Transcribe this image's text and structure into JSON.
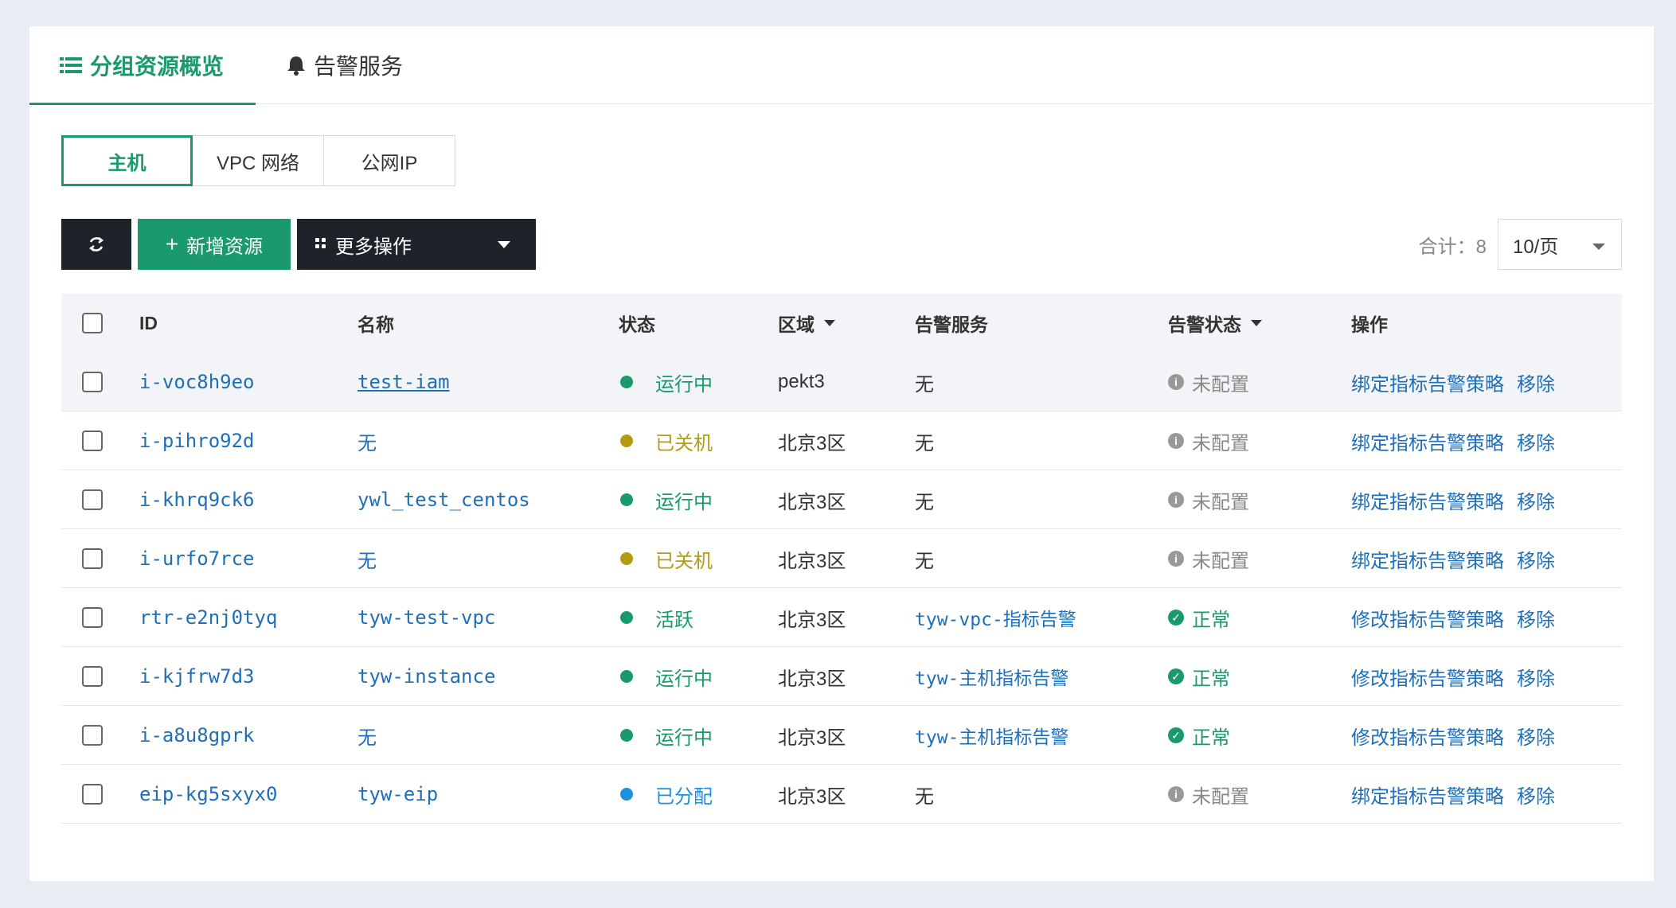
{
  "tabs": [
    {
      "label": "分组资源概览",
      "active": true,
      "icon": "list-icon"
    },
    {
      "label": "告警服务",
      "active": false,
      "icon": "bell-icon"
    }
  ],
  "segments": [
    {
      "label": "主机",
      "active": true
    },
    {
      "label": "VPC 网络",
      "active": false
    },
    {
      "label": "公网IP",
      "active": false
    }
  ],
  "toolbar": {
    "refresh_icon": "refresh-icon",
    "add_label": "新增资源",
    "add_icon": "plus-icon",
    "more_label": "更多操作",
    "more_icon": "grid-icon"
  },
  "pagination": {
    "total_label": "合计：8",
    "page_size": "10/页"
  },
  "table": {
    "headers": {
      "id": "ID",
      "name": "名称",
      "status": "状态",
      "region": "区域",
      "alarm_service": "告警服务",
      "alarm_status": "告警状态",
      "ops": "操作"
    },
    "rows": [
      {
        "id": "i-voc8h9eo",
        "name": "test-iam",
        "name_link": true,
        "name_underline": true,
        "status": "运行中",
        "status_color": "#1a9a6c",
        "region": "pekt3",
        "alarm": "无",
        "alarm_link": false,
        "alarm_status": "未配置",
        "alarm_ok": false,
        "op1": "绑定指标告警策略",
        "op2": "移除",
        "highlight": true
      },
      {
        "id": "i-pihro92d",
        "name": "无",
        "name_link": true,
        "status": "已关机",
        "status_color": "#b59a14",
        "region": "北京3区",
        "alarm": "无",
        "alarm_link": false,
        "alarm_status": "未配置",
        "alarm_ok": false,
        "op1": "绑定指标告警策略",
        "op2": "移除"
      },
      {
        "id": "i-khrq9ck6",
        "name": "ywl_test_centos",
        "name_link": true,
        "status": "运行中",
        "status_color": "#1a9a6c",
        "region": "北京3区",
        "alarm": "无",
        "alarm_link": false,
        "alarm_status": "未配置",
        "alarm_ok": false,
        "op1": "绑定指标告警策略",
        "op2": "移除"
      },
      {
        "id": "i-urfo7rce",
        "name": "无",
        "name_link": true,
        "status": "已关机",
        "status_color": "#b59a14",
        "region": "北京3区",
        "alarm": "无",
        "alarm_link": false,
        "alarm_status": "未配置",
        "alarm_ok": false,
        "op1": "绑定指标告警策略",
        "op2": "移除"
      },
      {
        "id": "rtr-e2nj0tyq",
        "name": "tyw-test-vpc",
        "name_link": true,
        "status": "活跃",
        "status_color": "#1a9a6c",
        "region": "北京3区",
        "alarm": "tyw-vpc-指标告警",
        "alarm_link": true,
        "alarm_status": "正常",
        "alarm_ok": true,
        "op1": "修改指标告警策略",
        "op2": "移除"
      },
      {
        "id": "i-kjfrw7d3",
        "name": "tyw-instance",
        "name_link": true,
        "status": "运行中",
        "status_color": "#1a9a6c",
        "region": "北京3区",
        "alarm": "tyw-主机指标告警",
        "alarm_link": true,
        "alarm_status": "正常",
        "alarm_ok": true,
        "op1": "修改指标告警策略",
        "op2": "移除"
      },
      {
        "id": "i-a8u8gprk",
        "name": "无",
        "name_link": true,
        "status": "运行中",
        "status_color": "#1a9a6c",
        "region": "北京3区",
        "alarm": "tyw-主机指标告警",
        "alarm_link": true,
        "alarm_status": "正常",
        "alarm_ok": true,
        "op1": "修改指标告警策略",
        "op2": "移除"
      },
      {
        "id": "eip-kg5sxyx0",
        "name": "tyw-eip",
        "name_link": true,
        "status": "已分配",
        "status_color": "#1f8fe0",
        "region": "北京3区",
        "alarm": "无",
        "alarm_link": false,
        "alarm_status": "未配置",
        "alarm_ok": false,
        "op1": "绑定指标告警策略",
        "op2": "移除"
      }
    ]
  },
  "colors": {
    "accent": "#1a9a6c",
    "dark": "#1e2329",
    "link": "#1f6fb8",
    "muted": "#888888"
  }
}
